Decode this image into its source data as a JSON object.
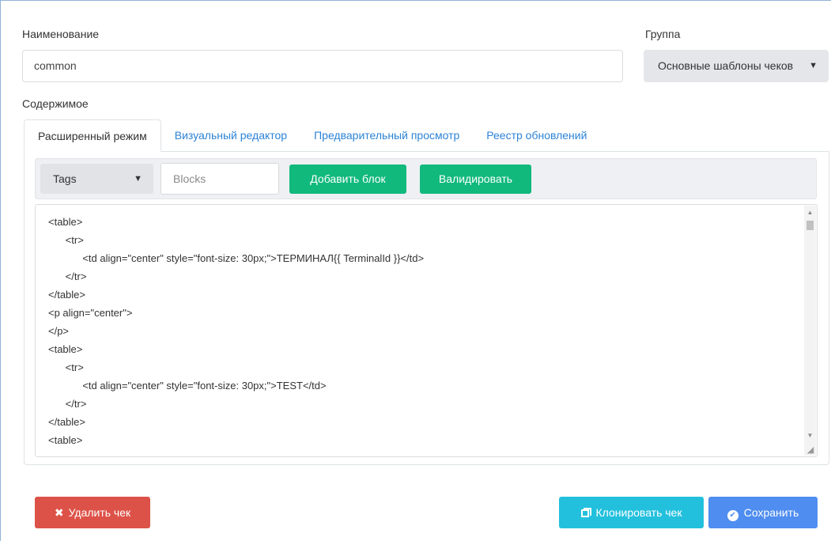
{
  "form": {
    "name_label": "Наименование",
    "name_value": "common",
    "group_label": "Группа",
    "group_value": "Основные шаблоны чеков",
    "content_label": "Содержимое"
  },
  "tabs": [
    {
      "label": "Расширенный режим",
      "active": true
    },
    {
      "label": "Визуальный редактор",
      "active": false
    },
    {
      "label": "Предварительный просмотр",
      "active": false
    },
    {
      "label": "Реестр обновлений",
      "active": false
    }
  ],
  "toolbar": {
    "tags_select_value": "Tags",
    "blocks_placeholder": "Blocks",
    "add_block_label": "Добавить блок",
    "validate_label": "Валидировать"
  },
  "code_lines": [
    "<table>",
    "      <tr>",
    "            <td align=\"center\" style=\"font-size: 30px;\">ТЕРМИНАЛ{{ TerminalId }}</td>",
    "      </tr>",
    "</table>",
    "<p align=\"center\">",
    "</p>",
    "<table>",
    "      <tr>",
    "            <td align=\"center\" style=\"font-size: 30px;\">TEST</td>",
    "      </tr>",
    "</table>",
    "<table>"
  ],
  "actions": {
    "delete_label": "Удалить чек",
    "clone_label": "Клонировать чек",
    "save_label": "Сохранить"
  },
  "colors": {
    "green": "#11b97d",
    "red": "#dd5248",
    "cyan": "#23c0dd",
    "blue": "#4f8df0",
    "tab_link": "#2c83d6"
  },
  "icons": {
    "select_caret": "caret-down-icon",
    "delete": "x-icon",
    "clone": "copy-icon",
    "save": "check-circle-icon"
  }
}
